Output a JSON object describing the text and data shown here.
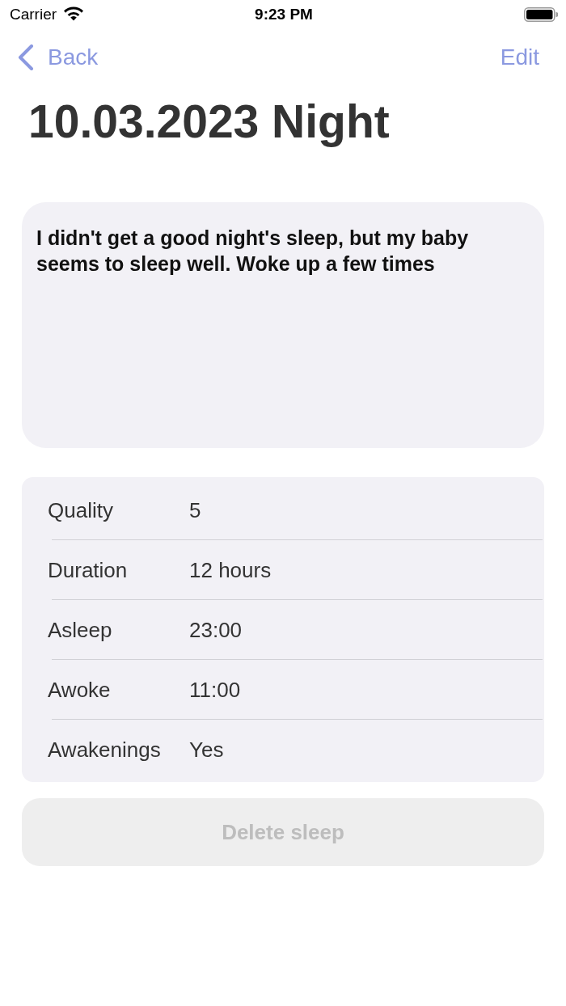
{
  "status_bar": {
    "carrier": "Carrier",
    "time": "9:23 PM"
  },
  "nav": {
    "back": "Back",
    "edit": "Edit"
  },
  "title": "10.03.2023 Night",
  "note": "I didn't get a good night's sleep, but my baby seems to sleep well. Woke up a few times",
  "details": [
    {
      "label": "Quality",
      "value": "5"
    },
    {
      "label": "Duration",
      "value": "12 hours"
    },
    {
      "label": "Asleep",
      "value": "23:00"
    },
    {
      "label": "Awoke",
      "value": "11:00"
    },
    {
      "label": "Awakenings",
      "value": "Yes"
    }
  ],
  "delete_button": {
    "label": "Delete sleep",
    "disabled": true
  }
}
